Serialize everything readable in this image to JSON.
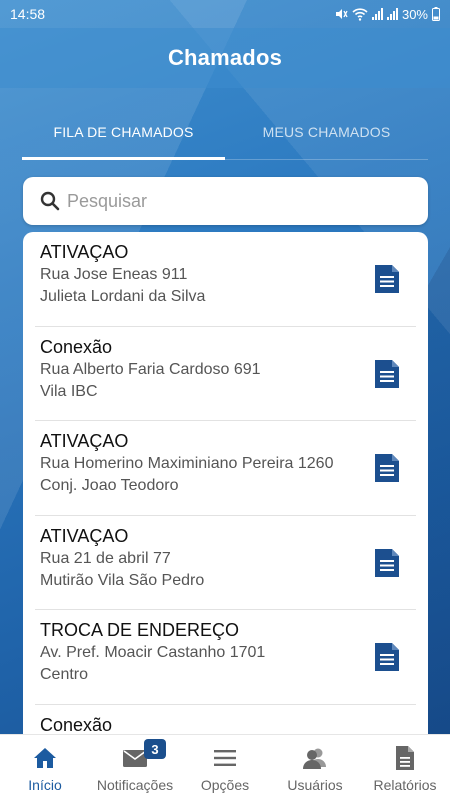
{
  "status_bar": {
    "time": "14:58",
    "battery": "30%"
  },
  "header": {
    "title": "Chamados"
  },
  "tabs": [
    {
      "label": "FILA DE CHAMADOS",
      "active": true
    },
    {
      "label": "MEUS CHAMADOS",
      "active": false
    }
  ],
  "search": {
    "placeholder": "Pesquisar",
    "value": ""
  },
  "tickets": [
    {
      "title": "ATIVAÇAO",
      "address": "Rua Jose Eneas 911",
      "detail": "Julieta Lordani da Silva",
      "icon": "document-icon"
    },
    {
      "title": "Conexão",
      "address": "Rua Alberto Faria Cardoso 691",
      "detail": "Vila IBC",
      "icon": "document-icon"
    },
    {
      "title": "ATIVAÇAO",
      "address": "Rua Homerino Maximiniano Pereira 1260",
      "detail": "Conj. Joao Teodoro",
      "icon": "document-icon"
    },
    {
      "title": "ATIVAÇAO",
      "address": "Rua 21 de abril 77",
      "detail": "Mutirão Vila São Pedro",
      "icon": "document-icon"
    },
    {
      "title": "TROCA DE ENDEREÇO",
      "address": "Av. Pref. Moacir Castanho 1701",
      "detail": "Centro",
      "icon": "document-icon"
    },
    {
      "title": "Conexão",
      "address": "",
      "detail": "",
      "icon": "document-icon"
    }
  ],
  "bottom_nav": [
    {
      "label": "Início",
      "icon": "home-icon",
      "active": true
    },
    {
      "label": "Notificações",
      "icon": "mail-icon",
      "badge": "3"
    },
    {
      "label": "Opções",
      "icon": "menu-icon"
    },
    {
      "label": "Usuários",
      "icon": "users-icon"
    },
    {
      "label": "Relatórios",
      "icon": "report-icon"
    }
  ],
  "colors": {
    "accent": "#1c5ba0",
    "header_bg": "#3b8ad0",
    "badge": "#1b4f8d"
  }
}
